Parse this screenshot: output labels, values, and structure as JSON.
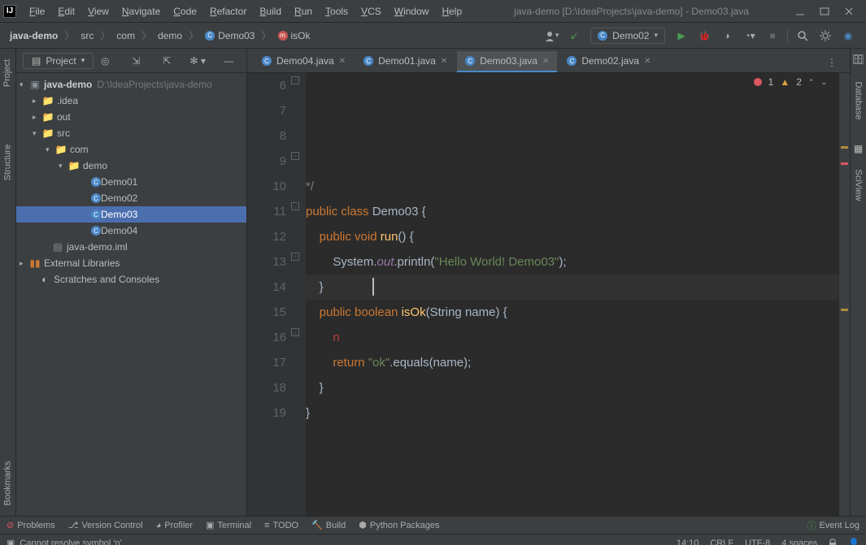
{
  "title": "java-demo [D:\\IdeaProjects\\java-demo] - Demo03.java",
  "menu": [
    "File",
    "Edit",
    "View",
    "Navigate",
    "Code",
    "Refactor",
    "Build",
    "Run",
    "Tools",
    "VCS",
    "Window",
    "Help"
  ],
  "breadcrumbs": {
    "project": "java-demo",
    "folders": [
      "src",
      "com",
      "demo"
    ],
    "class": "Demo03",
    "method": "isOk"
  },
  "runconfig": "Demo02",
  "sidebar": {
    "title": "Project",
    "tree": {
      "root": {
        "label": "java-demo",
        "path": "D:\\IdeaProjects\\java-demo"
      },
      "idea": ".idea",
      "out": "out",
      "src": "src",
      "com": "com",
      "demo": "demo",
      "classes": [
        "Demo01",
        "Demo02",
        "Demo03",
        "Demo04"
      ],
      "iml": "java-demo.iml",
      "external": "External Libraries",
      "scratch": "Scratches and Consoles"
    }
  },
  "left_tools": [
    "Bookmarks",
    "Structure",
    "Project"
  ],
  "right_tools": [
    "Database",
    "SciView"
  ],
  "tabs": [
    {
      "label": "Demo04.java",
      "active": false
    },
    {
      "label": "Demo01.java",
      "active": false
    },
    {
      "label": "Demo03.java",
      "active": true
    },
    {
      "label": "Demo02.java",
      "active": false
    }
  ],
  "gutter_start": 6,
  "gutter_end": 19,
  "code_lines": [
    {
      "n": 6,
      "html": "<span class='comment'>*/</span>"
    },
    {
      "n": 7,
      "html": "<span class='kw'>public class</span> Demo03 {"
    },
    {
      "n": 8,
      "html": ""
    },
    {
      "n": 9,
      "html": "    <span class='kw'>public void</span> <span class='funcname'>run</span>() {"
    },
    {
      "n": 10,
      "html": "        System.<span class='field'>out</span>.println(<span class='str'>\"Hello World! Demo03\"</span>);"
    },
    {
      "n": 11,
      "html": "    }"
    },
    {
      "n": 12,
      "html": ""
    },
    {
      "n": 13,
      "html": "    <span class='kw'>public boolean</span> <span class='funcname'>isOk</span>(String name) {"
    },
    {
      "n": 14,
      "html": "        <span class='err'>n</span>"
    },
    {
      "n": 15,
      "html": "        <span class='kw'>return</span> <span class='str'>\"ok\"</span>.equals(name);"
    },
    {
      "n": 16,
      "html": "    }"
    },
    {
      "n": 17,
      "html": ""
    },
    {
      "n": 18,
      "html": "}"
    },
    {
      "n": 19,
      "html": ""
    }
  ],
  "inspection": {
    "errors": "1",
    "warnings": "2"
  },
  "bottom_tabs": [
    "Problems",
    "Version Control",
    "Profiler",
    "Terminal",
    "TODO",
    "Build",
    "Python Packages"
  ],
  "event_log": "Event Log",
  "status": {
    "message": "Cannot resolve symbol 'n'",
    "pos": "14:10",
    "line_sep": "CRLF",
    "encoding": "UTF-8",
    "indent": "4 spaces"
  }
}
